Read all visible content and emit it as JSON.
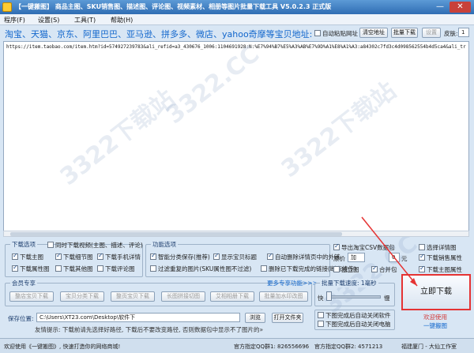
{
  "window": {
    "title": "【一键搬图】 商品主图、SKU销售图、描述图、评论图、视频素材、相册等图片批量下载工具 V5.0.2.3 正式版",
    "minimize": "—",
    "close": "✕"
  },
  "menu": [
    "程序(F)",
    "设置(S)",
    "工具(T)",
    "帮助(H)"
  ],
  "urlbar": {
    "title": "淘宝、天猫、京东、阿里巴巴、亚马逊、拼多多、微店、yahoo奇摩等宝贝地址:",
    "auto_paste_label": "自动粘贴网址",
    "clear_btn": "清空地址",
    "goto_btn": "批量下载",
    "settings_btn": "设置",
    "skin_label": "皮肤:",
    "skin_value": "1"
  },
  "url_area": {
    "text": "https://item.taobao.com/item.htm?id=574927239783&ali_refid=a3_430676_1006:1104691928:N:%E7%94%B7%E5%A3%AB%E7%9D%A1%E8%A1%A3:a84302c7fd3c4d098562554b4d5ca4&ali_trackid=1_a84302c7fd3c4d0985625544b4d5ca4&spm=a2e15.8261149.07626516002.1"
  },
  "watermark": [
    "3322下载站",
    "3322下载站",
    "3322.CC",
    "3322.CC"
  ],
  "download_options": {
    "title": "下载选项",
    "items": [
      {
        "label": "下载主图",
        "checked": true
      },
      {
        "label": "下载细节图",
        "checked": true
      },
      {
        "label": "下载手机详情",
        "checked": true
      },
      {
        "label": "下载属性图",
        "checked": true
      },
      {
        "label": "下载其他图",
        "checked": false
      },
      {
        "label": "下载评论图",
        "checked": false
      }
    ],
    "sync_video_label": "同时下载视频(主图、描述、评论)"
  },
  "function_options": {
    "title": "功能选项",
    "items": [
      {
        "label": "智能分类保存(推荐)",
        "checked": true
      },
      {
        "label": "显示宝贝标题",
        "checked": true
      },
      {
        "label": "自动删除详情页中的外链",
        "checked": true
      },
      {
        "label": "过滤重复的图片(SKU属性图不过滤)",
        "checked": false
      },
      {
        "label": "删除已下载完成的链接(断点续传)",
        "checked": false
      }
    ]
  },
  "right_options": {
    "csv_label": "导出淘宝CSV数据包",
    "original_price_label": "原价",
    "add_label": "加",
    "price_value": "0",
    "yuan_label": "元",
    "only_image_label": "独立图",
    "merge_label": "合并包",
    "selected_watermark_label": "选择详情图",
    "download_sku_label": "下载销售属性",
    "download_detail_label": "下载主图属性"
  },
  "member": {
    "title": "会员专享",
    "more_link": "更多专享功能>>>",
    "buttons": [
      "整店宝贝下载",
      "宝贝分类下载",
      "整页宝贝下载",
      "长图拼接切图",
      "艾相相册下载",
      "批量加水印改图"
    ]
  },
  "speed": {
    "title": "批量下载速度: 1毫秒",
    "fast": "快",
    "slow": "慢",
    "level": 0.05,
    "auto_shutdown_label": "下图完成后自动关闭软件",
    "auto_poweroff_label": "下图完成后自动关闭电脑"
  },
  "save": {
    "label": "保存位置:",
    "path": "C:\\Users\\XT23.com\\Desktop\\软件下",
    "browse_btn": "浏览",
    "open_btn": "打开文件夹",
    "tip": "友情提示: 下载前请先选择好路径, 下载后不要改变路径, 否则数据包中显示不了图片的»"
  },
  "go": {
    "label": "立即下载",
    "welcome": "欢迎使用",
    "app_name": "一键搬图"
  },
  "status": {
    "left": "欢迎使用《一键搬图》, 快速打造你的网络商城!",
    "qq1": "官方指定QQ群1: 826556696",
    "qq2": "官方指定QQ群2: 4571213",
    "company": "福建厦门 - 大仙工作室"
  },
  "colors": {
    "accent": "#1166cc",
    "highlight": "#e53333"
  }
}
